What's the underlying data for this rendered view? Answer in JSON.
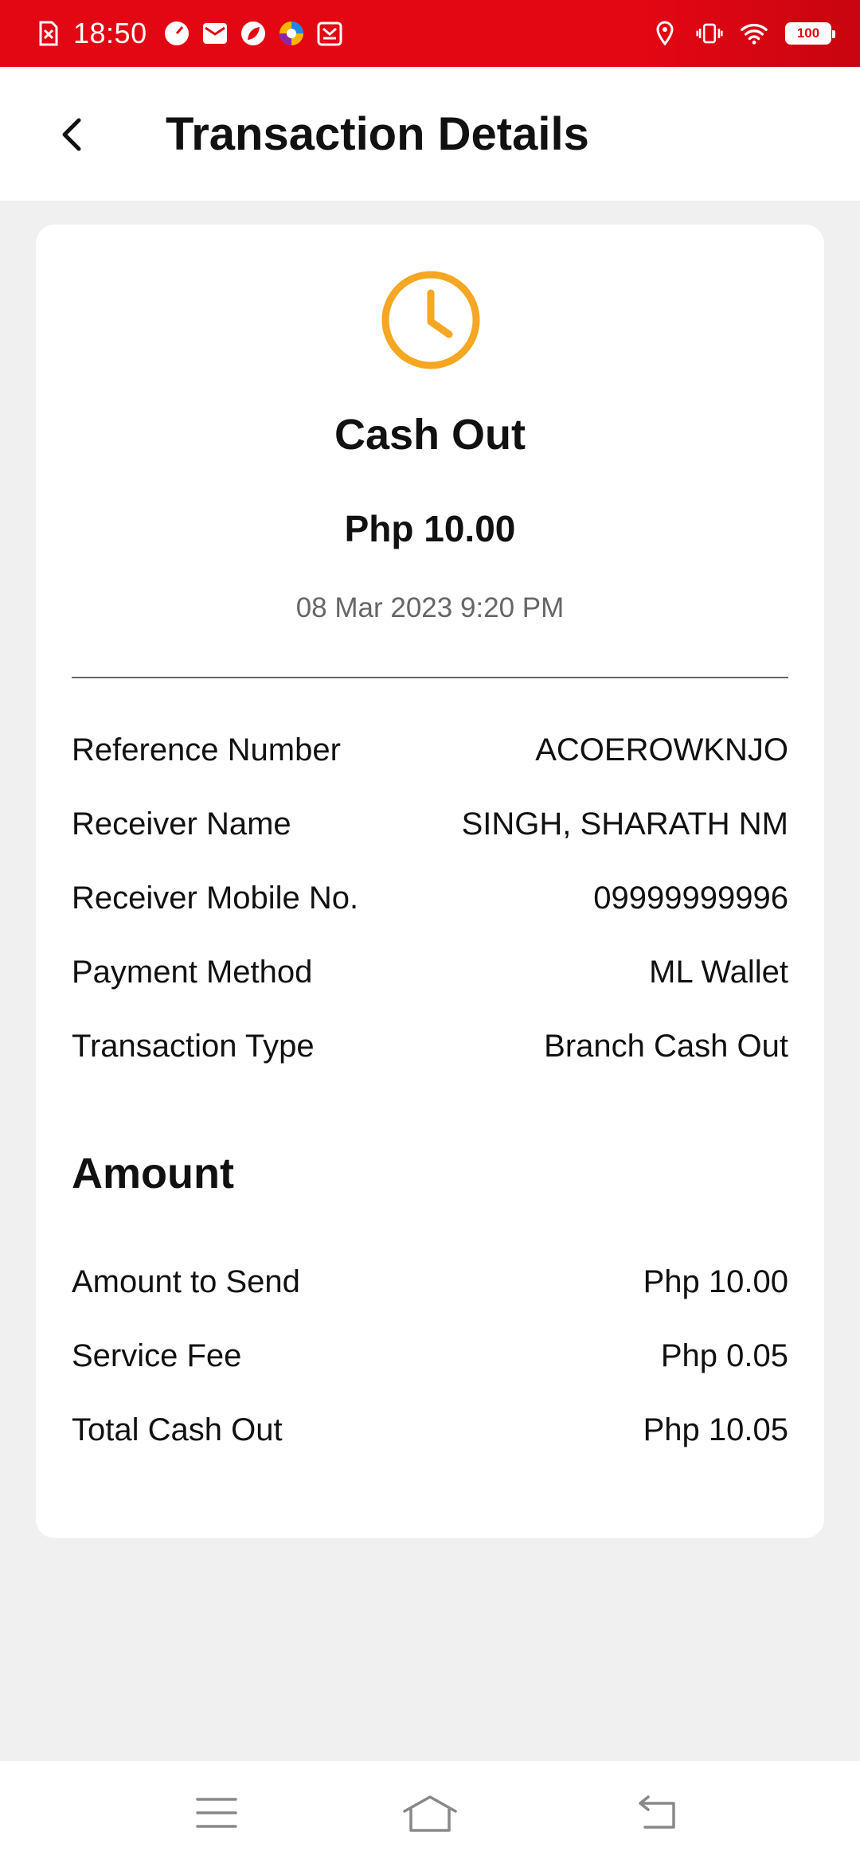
{
  "status_bar": {
    "time": "18:50",
    "battery": "100",
    "left_icons": [
      "sim-alert-icon",
      "speedometer-icon",
      "mail-icon",
      "leaf-icon",
      "browser-icon",
      "calendar-mail-icon"
    ],
    "right_icons": [
      "location-icon",
      "vibrate-icon",
      "wifi-icon",
      "battery-icon"
    ]
  },
  "header": {
    "back_icon": "chevron-left-icon",
    "title": "Transaction Details"
  },
  "summary": {
    "status_icon": "clock-icon",
    "status_color": "#F5A623",
    "type": "Cash Out",
    "amount": "Php 10.00",
    "date": "08 Mar 2023 9:20 PM"
  },
  "details": [
    {
      "label": "Reference Number",
      "value": "ACOEROWKNJO"
    },
    {
      "label": "Receiver Name",
      "value": "SINGH, SHARATH NM"
    },
    {
      "label": "Receiver Mobile No.",
      "value": "09999999996"
    },
    {
      "label": "Payment Method",
      "value": "ML Wallet"
    },
    {
      "label": "Transaction Type",
      "value": "Branch Cash Out"
    }
  ],
  "amount_section": {
    "title": "Amount",
    "rows": [
      {
        "label": "Amount to Send",
        "value": "Php 10.00"
      },
      {
        "label": "Service Fee",
        "value": "Php 0.05"
      },
      {
        "label": "Total Cash Out",
        "value": "Php 10.05"
      }
    ]
  },
  "nav_bar": {
    "buttons": [
      "menu-icon",
      "home-icon",
      "back-icon"
    ]
  },
  "colors": {
    "brand_red": "#E30613",
    "accent_orange": "#F5A623",
    "background": "#F0F0F0"
  }
}
